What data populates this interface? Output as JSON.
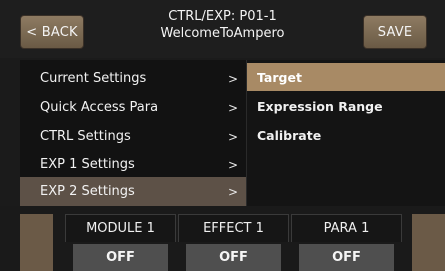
{
  "header": {
    "back_label": "< BACK",
    "save_label": "SAVE",
    "title_line1": "CTRL/EXP: P01-1",
    "title_line2": "WelcomeToAmpero"
  },
  "menu": {
    "items": [
      {
        "label": "Current Settings",
        "arrow": ">"
      },
      {
        "label": "Quick Access Para",
        "arrow": ">"
      },
      {
        "label": "CTRL Settings",
        "arrow": ">"
      },
      {
        "label": "EXP 1 Settings",
        "arrow": ">"
      },
      {
        "label": "EXP 2 Settings",
        "arrow": ">"
      }
    ],
    "active_index": 4
  },
  "submenu": {
    "items": [
      {
        "label": "Target"
      },
      {
        "label": "Expression Range"
      },
      {
        "label": "Calibrate"
      }
    ],
    "active_index": 0
  },
  "params": [
    {
      "label": "MODULE 1",
      "value": "OFF"
    },
    {
      "label": "EFFECT 1",
      "value": "OFF"
    },
    {
      "label": "PARA 1",
      "value": "OFF"
    }
  ],
  "colors": {
    "button": "#7e6b54",
    "active_left": "#5d5147",
    "active_right": "#a88a65",
    "value_box": "#4f4f4f"
  }
}
